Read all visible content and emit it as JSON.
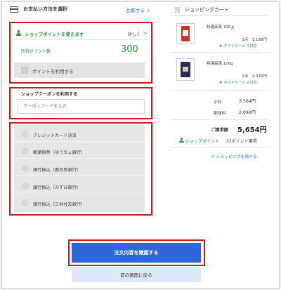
{
  "payment": {
    "title": "お支払い方法を選択",
    "link": "比較する ＞"
  },
  "points": {
    "title": "ショップポイントを使えます",
    "detail": "詳しく",
    "chevron": "＞",
    "owned_label": "所持ポイント数",
    "owned_value": "300",
    "use_label": "ポイントを利用する"
  },
  "coupon": {
    "title": "ショップクーポンを利用する",
    "placeholder": "クーポンコードを入力"
  },
  "methods": [
    {
      "label": "クレジットカード決済"
    },
    {
      "label": "郵便振替（ゆうちょ銀行）"
    },
    {
      "label": "銀行振込（鹿児島銀行）"
    },
    {
      "label": "銀行振込（みずほ銀行）"
    },
    {
      "label": "銀行振込（三井住友銀行）"
    }
  ],
  "cart": {
    "title": "ショッピングカート",
    "items": [
      {
        "name": "特選高馬 100ｇ",
        "qty": "1点　1,188円",
        "gift": "❀ ギフトサービス対応"
      },
      {
        "name": "特選高馬 100g",
        "qty": "1点　2,376円",
        "gift": "❀ ギフトサービス対応"
      }
    ],
    "subtotal_label": "小計",
    "subtotal_value": "3,564円",
    "shipping_label": "配送料",
    "shipping_value": "2,090円",
    "total_label": "ご請求額",
    "total_value": "5,654円",
    "earn_label": "ショップポイント",
    "earn_value": "33ポイント獲得",
    "continue_link": "＜ ショッピングを続ける"
  },
  "actions": {
    "confirm": "注文内容を確認する",
    "back": "前の画面に戻る"
  },
  "colors": {
    "accent": "#2e68d8",
    "highlight": "#d11b1b",
    "points_green": "#2f8f4e"
  }
}
